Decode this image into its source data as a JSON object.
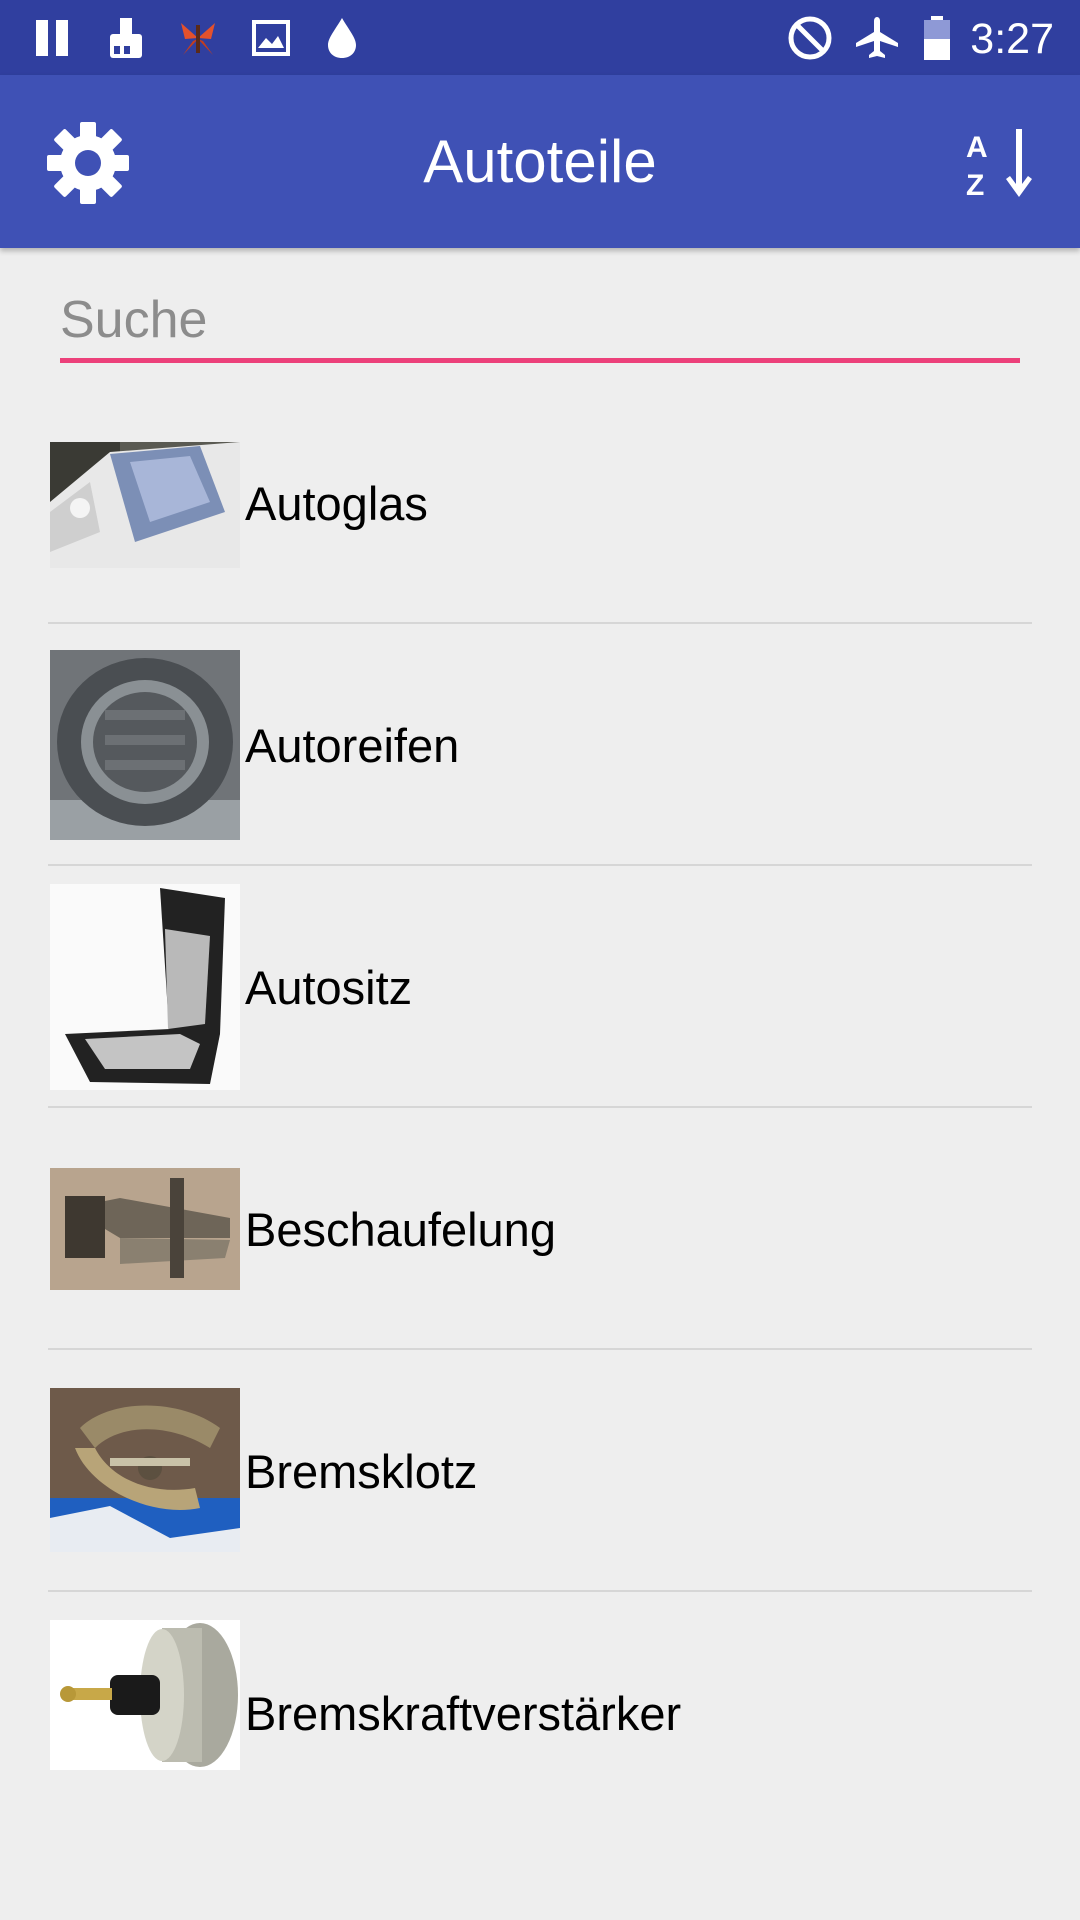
{
  "status_bar": {
    "time": "3:27",
    "left_icons": [
      "pause-icon",
      "paint-bucket-icon",
      "butterfly-icon",
      "image-icon",
      "water-drop-icon"
    ],
    "right_icons": [
      "do-not-disturb-icon",
      "airplane-mode-icon",
      "battery-icon"
    ]
  },
  "app_bar": {
    "title": "Autoteile",
    "settings_icon": "gear-icon",
    "sort_icon": "sort-az-icon"
  },
  "search": {
    "placeholder": "Suche",
    "value": ""
  },
  "items": [
    {
      "label": "Autoglas",
      "image": "car-windshield-photo"
    },
    {
      "label": "Autoreifen",
      "image": "tire-stack-photo"
    },
    {
      "label": "Autositz",
      "image": "car-seat-photo"
    },
    {
      "label": "Beschaufelung",
      "image": "turbine-blade-photo"
    },
    {
      "label": "Bremsklotz",
      "image": "brake-shoes-photo"
    },
    {
      "label": "Bremskraftverstärker",
      "image": "brake-booster-photo"
    }
  ],
  "colors": {
    "status_bar": "#303f9f",
    "app_bar": "#3f51b5",
    "accent": "#ec407a",
    "background": "#eeeeee"
  }
}
